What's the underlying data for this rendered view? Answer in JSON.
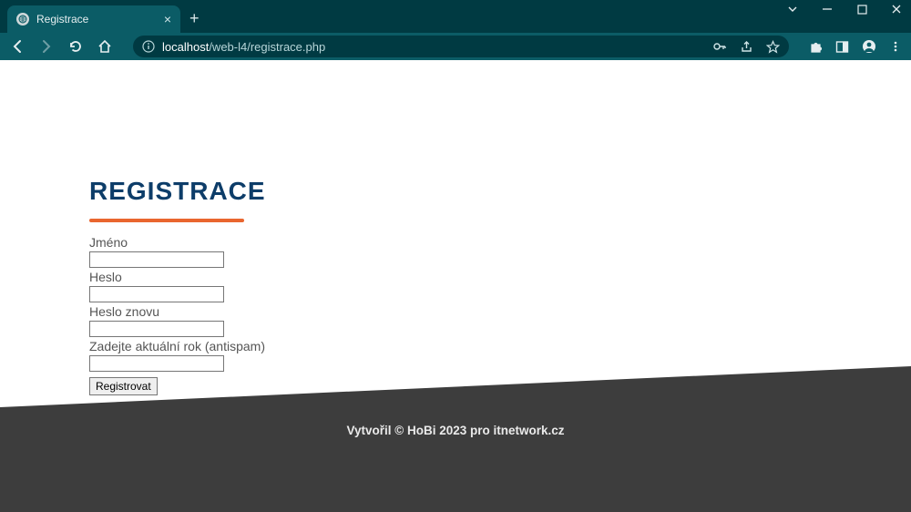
{
  "browser": {
    "tab_title": "Registrace",
    "url_prefix": "localhost",
    "url_path": "/web-l4/registrace.php"
  },
  "page": {
    "heading": "REGISTRACE",
    "labels": {
      "name": "Jméno",
      "password": "Heslo",
      "password_again": "Heslo znovu",
      "antispam": "Zadejte aktuální rok (antispam)"
    },
    "submit_label": "Registrovat",
    "footer": "Vytvořil © HoBi 2023 pro itnetwork.cz"
  }
}
